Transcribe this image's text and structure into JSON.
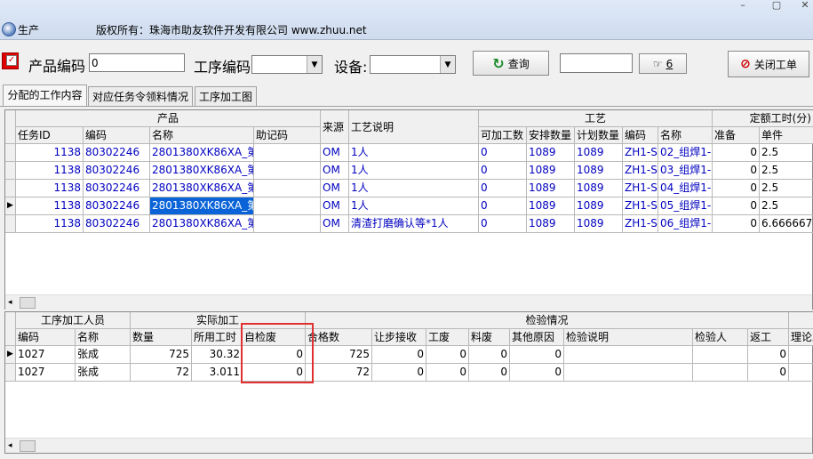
{
  "window": {
    "title": "生产",
    "copyright": "版权所有：珠海市助友软件开发有限公司 www.zhuu.net"
  },
  "toolbar": {
    "product_code_label": "产品编码",
    "product_code_value": "0",
    "process_code_label": "工序编码",
    "device_label": "设备:",
    "query_label": "查询",
    "search_count": "6",
    "close_order_label": "关闭工单"
  },
  "tabs": [
    "分配的工作内容",
    "对应任务令领料情况",
    "工序加工图"
  ],
  "top_grid": {
    "groups": {
      "product": "产品",
      "source": "来源",
      "desc": "工艺说明",
      "process": "工艺",
      "quota": "定额工时(分)"
    },
    "columns": [
      "任务ID",
      "编码",
      "名称",
      "助记码",
      "可加工数",
      "安排数量",
      "计划数量",
      "编码",
      "名称",
      "准备",
      "单件"
    ],
    "rows": [
      [
        "1138",
        "80302246",
        "2801380XK86XA_第",
        "",
        "OM",
        "1人",
        "0",
        "1089",
        "1089",
        "ZH1-S",
        "02_组焊1-",
        "0",
        "2.5"
      ],
      [
        "1138",
        "80302246",
        "2801380XK86XA_第",
        "",
        "OM",
        "1人",
        "0",
        "1089",
        "1089",
        "ZH1-S",
        "03_组焊1-",
        "0",
        "2.5"
      ],
      [
        "1138",
        "80302246",
        "2801380XK86XA_第",
        "",
        "OM",
        "1人",
        "0",
        "1089",
        "1089",
        "ZH1-S",
        "04_组焊1-",
        "0",
        "2.5"
      ],
      [
        "1138",
        "80302246",
        "2801380XK86XA_第",
        "",
        "OM",
        "1人",
        "0",
        "1089",
        "1089",
        "ZH1-S",
        "05_组焊1-",
        "0",
        "2.5"
      ],
      [
        "1138",
        "80302246",
        "2801380XK86XA_第",
        "",
        "OM",
        "清渣打磨确认等*1人",
        "0",
        "1089",
        "1089",
        "ZH1-S",
        "06_组焊1-",
        "0",
        "6.666667"
      ]
    ]
  },
  "bottom_grid": {
    "groups": {
      "worker": "工序加工人员",
      "actual": "实际加工",
      "inspection": "检验情况"
    },
    "columns": [
      "编码",
      "名称",
      "数量",
      "所用工时",
      "自检废",
      "合格数",
      "让步接收",
      "工废",
      "料废",
      "其他原因",
      "检验说明",
      "检验人",
      "返工",
      "理论工"
    ],
    "rows": [
      [
        "1027",
        "张成",
        "725",
        "30.32",
        "0",
        "725",
        "0",
        "0",
        "0",
        "0",
        "",
        "",
        "0",
        ""
      ],
      [
        "1027",
        "张成",
        "72",
        "3.011",
        "0",
        "72",
        "0",
        "0",
        "0",
        "0",
        "",
        "",
        "0",
        ""
      ]
    ]
  },
  "colors": {
    "selection": "#0a64d8",
    "highlight_box": "#e03030",
    "number_text": "#0000c0"
  }
}
